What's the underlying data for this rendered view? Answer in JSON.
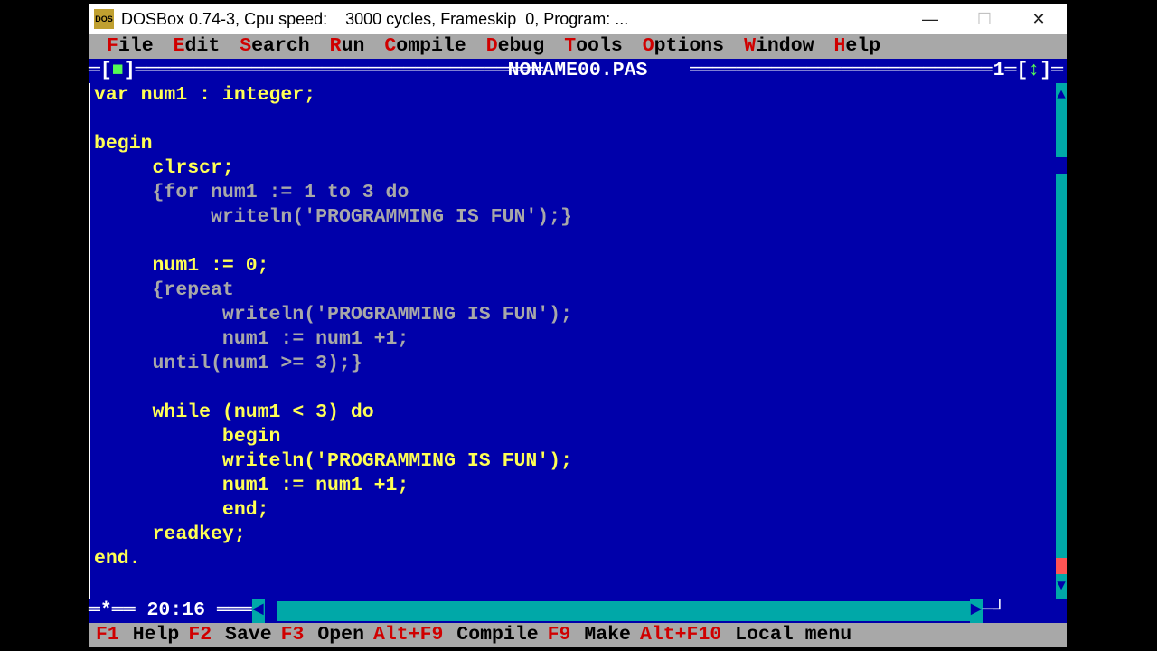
{
  "window": {
    "title": "DOSBox 0.74-3, Cpu speed:    3000 cycles, Frameskip  0, Program: ...",
    "icon_text": "DOS\nBOX"
  },
  "menu": {
    "items": [
      {
        "hot": "F",
        "rest": "ile"
      },
      {
        "hot": "E",
        "rest": "dit"
      },
      {
        "hot": "S",
        "rest": "earch"
      },
      {
        "hot": "R",
        "rest": "un"
      },
      {
        "hot": "C",
        "rest": "ompile"
      },
      {
        "hot": "D",
        "rest": "ebug"
      },
      {
        "hot": "T",
        "rest": "ools"
      },
      {
        "hot": "O",
        "rest": "ptions"
      },
      {
        "hot": "W",
        "rest": "indow"
      },
      {
        "hot": "H",
        "rest": "elp"
      }
    ]
  },
  "editor": {
    "filename": " NONAME00.PAS ",
    "window_number": "1",
    "cursor_position": " 20:16 ",
    "code": [
      {
        "t": "var num1 : integer;",
        "c": false
      },
      {
        "t": "",
        "c": false
      },
      {
        "t": "begin",
        "c": false
      },
      {
        "t": "     clrscr;",
        "c": false
      },
      {
        "t": "     {for num1 := 1 to 3 do",
        "c": true
      },
      {
        "t": "          writeln('PROGRAMMING IS FUN');}",
        "c": true
      },
      {
        "t": "",
        "c": false
      },
      {
        "t": "     num1 := 0;",
        "c": false
      },
      {
        "t": "     {repeat",
        "c": true
      },
      {
        "t": "           writeln('PROGRAMMING IS FUN');",
        "c": true
      },
      {
        "t": "           num1 := num1 +1;",
        "c": true
      },
      {
        "t": "     until(num1 >= 3);}",
        "c": true
      },
      {
        "t": "",
        "c": false
      },
      {
        "t": "     while (num1 < 3) do",
        "c": false
      },
      {
        "t": "           begin",
        "c": false
      },
      {
        "t": "           writeln('PROGRAMMING IS FUN');",
        "c": false
      },
      {
        "t": "           num1 := num1 +1;",
        "c": false
      },
      {
        "t": "           end;",
        "c": false
      },
      {
        "t": "     readkey;",
        "c": false
      },
      {
        "t": "end.",
        "c": false
      }
    ]
  },
  "statusbar": {
    "items": [
      {
        "key": "F1",
        "label": " Help"
      },
      {
        "key": "F2",
        "label": " Save"
      },
      {
        "key": "F3",
        "label": " Open"
      },
      {
        "key": "Alt+F9",
        "label": " Compile"
      },
      {
        "key": "F9",
        "label": " Make"
      },
      {
        "key": "Alt+F10",
        "label": " Local menu"
      }
    ]
  }
}
